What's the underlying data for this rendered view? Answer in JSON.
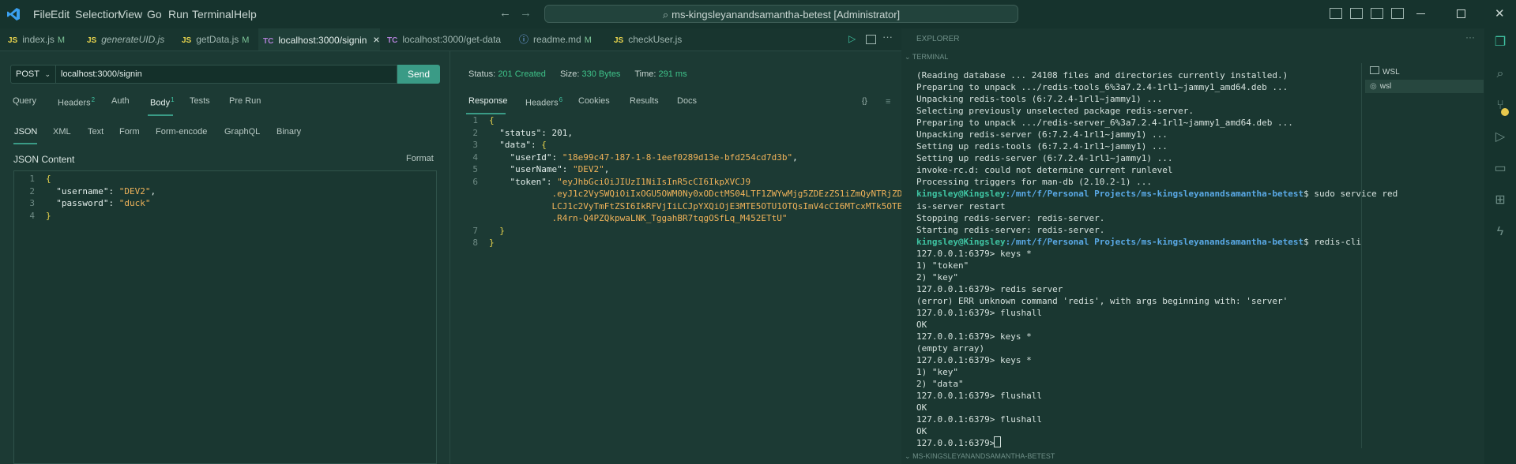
{
  "menu": [
    "File",
    "Edit",
    "Selection",
    "View",
    "Go",
    "Run",
    "Terminal",
    "Help"
  ],
  "command_center": "ms-kingsleyanandsamantha-betest [Administrator]",
  "tabs": [
    {
      "icon": "JS",
      "label": "index.js",
      "mod": "M"
    },
    {
      "icon": "JS",
      "label": "generateUID.js",
      "mod": ""
    },
    {
      "icon": "JS",
      "label": "getData.js",
      "mod": "M"
    },
    {
      "icon": "TC",
      "label": "localhost:3000/signin",
      "mod": "×"
    },
    {
      "icon": "TC",
      "label": "localhost:3000/get-data",
      "mod": ""
    },
    {
      "icon": "ⓘ",
      "label": "readme.md",
      "mod": "M"
    },
    {
      "icon": "JS",
      "label": "checkUser.js",
      "mod": ""
    }
  ],
  "request": {
    "method": "POST",
    "url": "localhost:3000/signin",
    "send": "Send",
    "subtabs": [
      {
        "label": "Query",
        "count": ""
      },
      {
        "label": "Headers",
        "count": "2"
      },
      {
        "label": "Auth",
        "count": ""
      },
      {
        "label": "Body",
        "count": "1"
      },
      {
        "label": "Tests",
        "count": ""
      },
      {
        "label": "Pre Run",
        "count": ""
      }
    ],
    "body_types": [
      "JSON",
      "XML",
      "Text",
      "Form",
      "Form-encode",
      "GraphQL",
      "Binary"
    ],
    "json_content_label": "JSON Content",
    "format": "Format",
    "body_lines": [
      {
        "n": "1",
        "text": "{"
      },
      {
        "n": "2",
        "key": "\"username\"",
        "val": "\"DEV2\"",
        "end": ","
      },
      {
        "n": "3",
        "key": "\"password\"",
        "val": "\"duck\"",
        "end": ""
      },
      {
        "n": "4",
        "text": "}"
      }
    ]
  },
  "response": {
    "status_label": "Status:",
    "status": "201 Created",
    "size_label": "Size:",
    "size": "330 Bytes",
    "time_label": "Time:",
    "time": "291 ms",
    "subtabs": [
      {
        "label": "Response",
        "count": ""
      },
      {
        "label": "Headers",
        "count": "6"
      },
      {
        "label": "Cookies",
        "count": ""
      },
      {
        "label": "Results",
        "count": ""
      },
      {
        "label": "Docs",
        "count": ""
      }
    ],
    "braces_icon": "{}",
    "lines": [
      {
        "n": "1",
        "indent": 0,
        "text": "{"
      },
      {
        "n": "2",
        "indent": 1,
        "key": "\"status\"",
        "num": "201",
        "end": ","
      },
      {
        "n": "3",
        "indent": 1,
        "key": "\"data\"",
        "text": "{"
      },
      {
        "n": "4",
        "indent": 2,
        "key": "\"userId\"",
        "val": "\"18e99c47-187-1-8-1eef0289d13e-bfd254cd7d3b\"",
        "end": ","
      },
      {
        "n": "5",
        "indent": 2,
        "key": "\"userName\"",
        "val": "\"DEV2\"",
        "end": ","
      },
      {
        "n": "6",
        "indent": 2,
        "key": "\"token\"",
        "val": "\"eyJhbGciOiJIUzI1NiIsInR5cCI6IkpXVCJ9"
      },
      {
        "n": "",
        "indent": 3,
        "val": ".eyJ1c2VySWQiOiIxOGU5OWM0Ny0xODctMS04LTF1ZWYwMjg5ZDEzZS1iZmQyNTRjZDdkM2Ii"
      },
      {
        "n": "",
        "indent": 3,
        "val": "LCJ1c2VyTmFtZSI6IkRFVjIiLCJpYXQiOjE3MTE5OTU1OTQsImV4cCI6MTcxMTk5OTE5NH0"
      },
      {
        "n": "",
        "indent": 3,
        "val": ".R4rn-Q4PZQkpwaLNK_TggahBR7tqgOSfLq_M452ETtU\""
      },
      {
        "n": "7",
        "indent": 1,
        "text": "}"
      },
      {
        "n": "8",
        "indent": 0,
        "text": "}"
      }
    ]
  },
  "explorer_label": "EXPLORER",
  "terminal_label": "TERMINAL",
  "footer_label": "MS-KINGSLEYANANDSAMANTHA-BETEST",
  "terminal_tabs": [
    "WSL",
    "wsl"
  ],
  "terminal": [
    {
      "t": "(Reading database ... 24108 files and directories currently installed.)"
    },
    {
      "t": "Preparing to unpack .../redis-tools_6%3a7.2.4-1rl1~jammy1_amd64.deb ..."
    },
    {
      "t": "Unpacking redis-tools (6:7.2.4-1rl1~jammy1) ..."
    },
    {
      "t": "Selecting previously unselected package redis-server."
    },
    {
      "t": "Preparing to unpack .../redis-server_6%3a7.2.4-1rl1~jammy1_amd64.deb ..."
    },
    {
      "t": "Unpacking redis-server (6:7.2.4-1rl1~jammy1) ..."
    },
    {
      "t": "Setting up redis-tools (6:7.2.4-1rl1~jammy1) ..."
    },
    {
      "t": "Setting up redis-server (6:7.2.4-1rl1~jammy1) ..."
    },
    {
      "t": "invoke-rc.d: could not determine current runlevel"
    },
    {
      "t": "Processing triggers for man-db (2.10.2-1) ..."
    },
    {
      "user": "kingsley@Kingsley",
      "path": ":/mnt/f/Personal Projects/ms-kingsleyanandsamantha-betest",
      "t": "$ sudo service red"
    },
    {
      "t": "is-server restart"
    },
    {
      "t": "Stopping redis-server: redis-server."
    },
    {
      "t": "Starting redis-server: redis-server."
    },
    {
      "user": "kingsley@Kingsley",
      "path": ":/mnt/f/Personal Projects/ms-kingsleyanandsamantha-betest",
      "t": "$ redis-cli"
    },
    {
      "t": "127.0.0.1:6379> keys *"
    },
    {
      "t": "1) \"token\""
    },
    {
      "t": "2) \"key\""
    },
    {
      "t": "127.0.0.1:6379> redis server"
    },
    {
      "t": "(error) ERR unknown command 'redis', with args beginning with: 'server'"
    },
    {
      "t": "127.0.0.1:6379> flushall"
    },
    {
      "t": "OK"
    },
    {
      "t": "127.0.0.1:6379> keys *"
    },
    {
      "t": "(empty array)"
    },
    {
      "t": "127.0.0.1:6379> keys *"
    },
    {
      "t": "1) \"key\""
    },
    {
      "t": "2) \"data\""
    },
    {
      "t": "127.0.0.1:6379> flushall"
    },
    {
      "t": "OK"
    },
    {
      "t": "127.0.0.1:6379> flushall"
    },
    {
      "t": "OK"
    },
    {
      "t": "127.0.0.1:6379> "
    }
  ],
  "colors": {
    "accent": "#3a9b86",
    "status_ok": "#3fc38a"
  }
}
